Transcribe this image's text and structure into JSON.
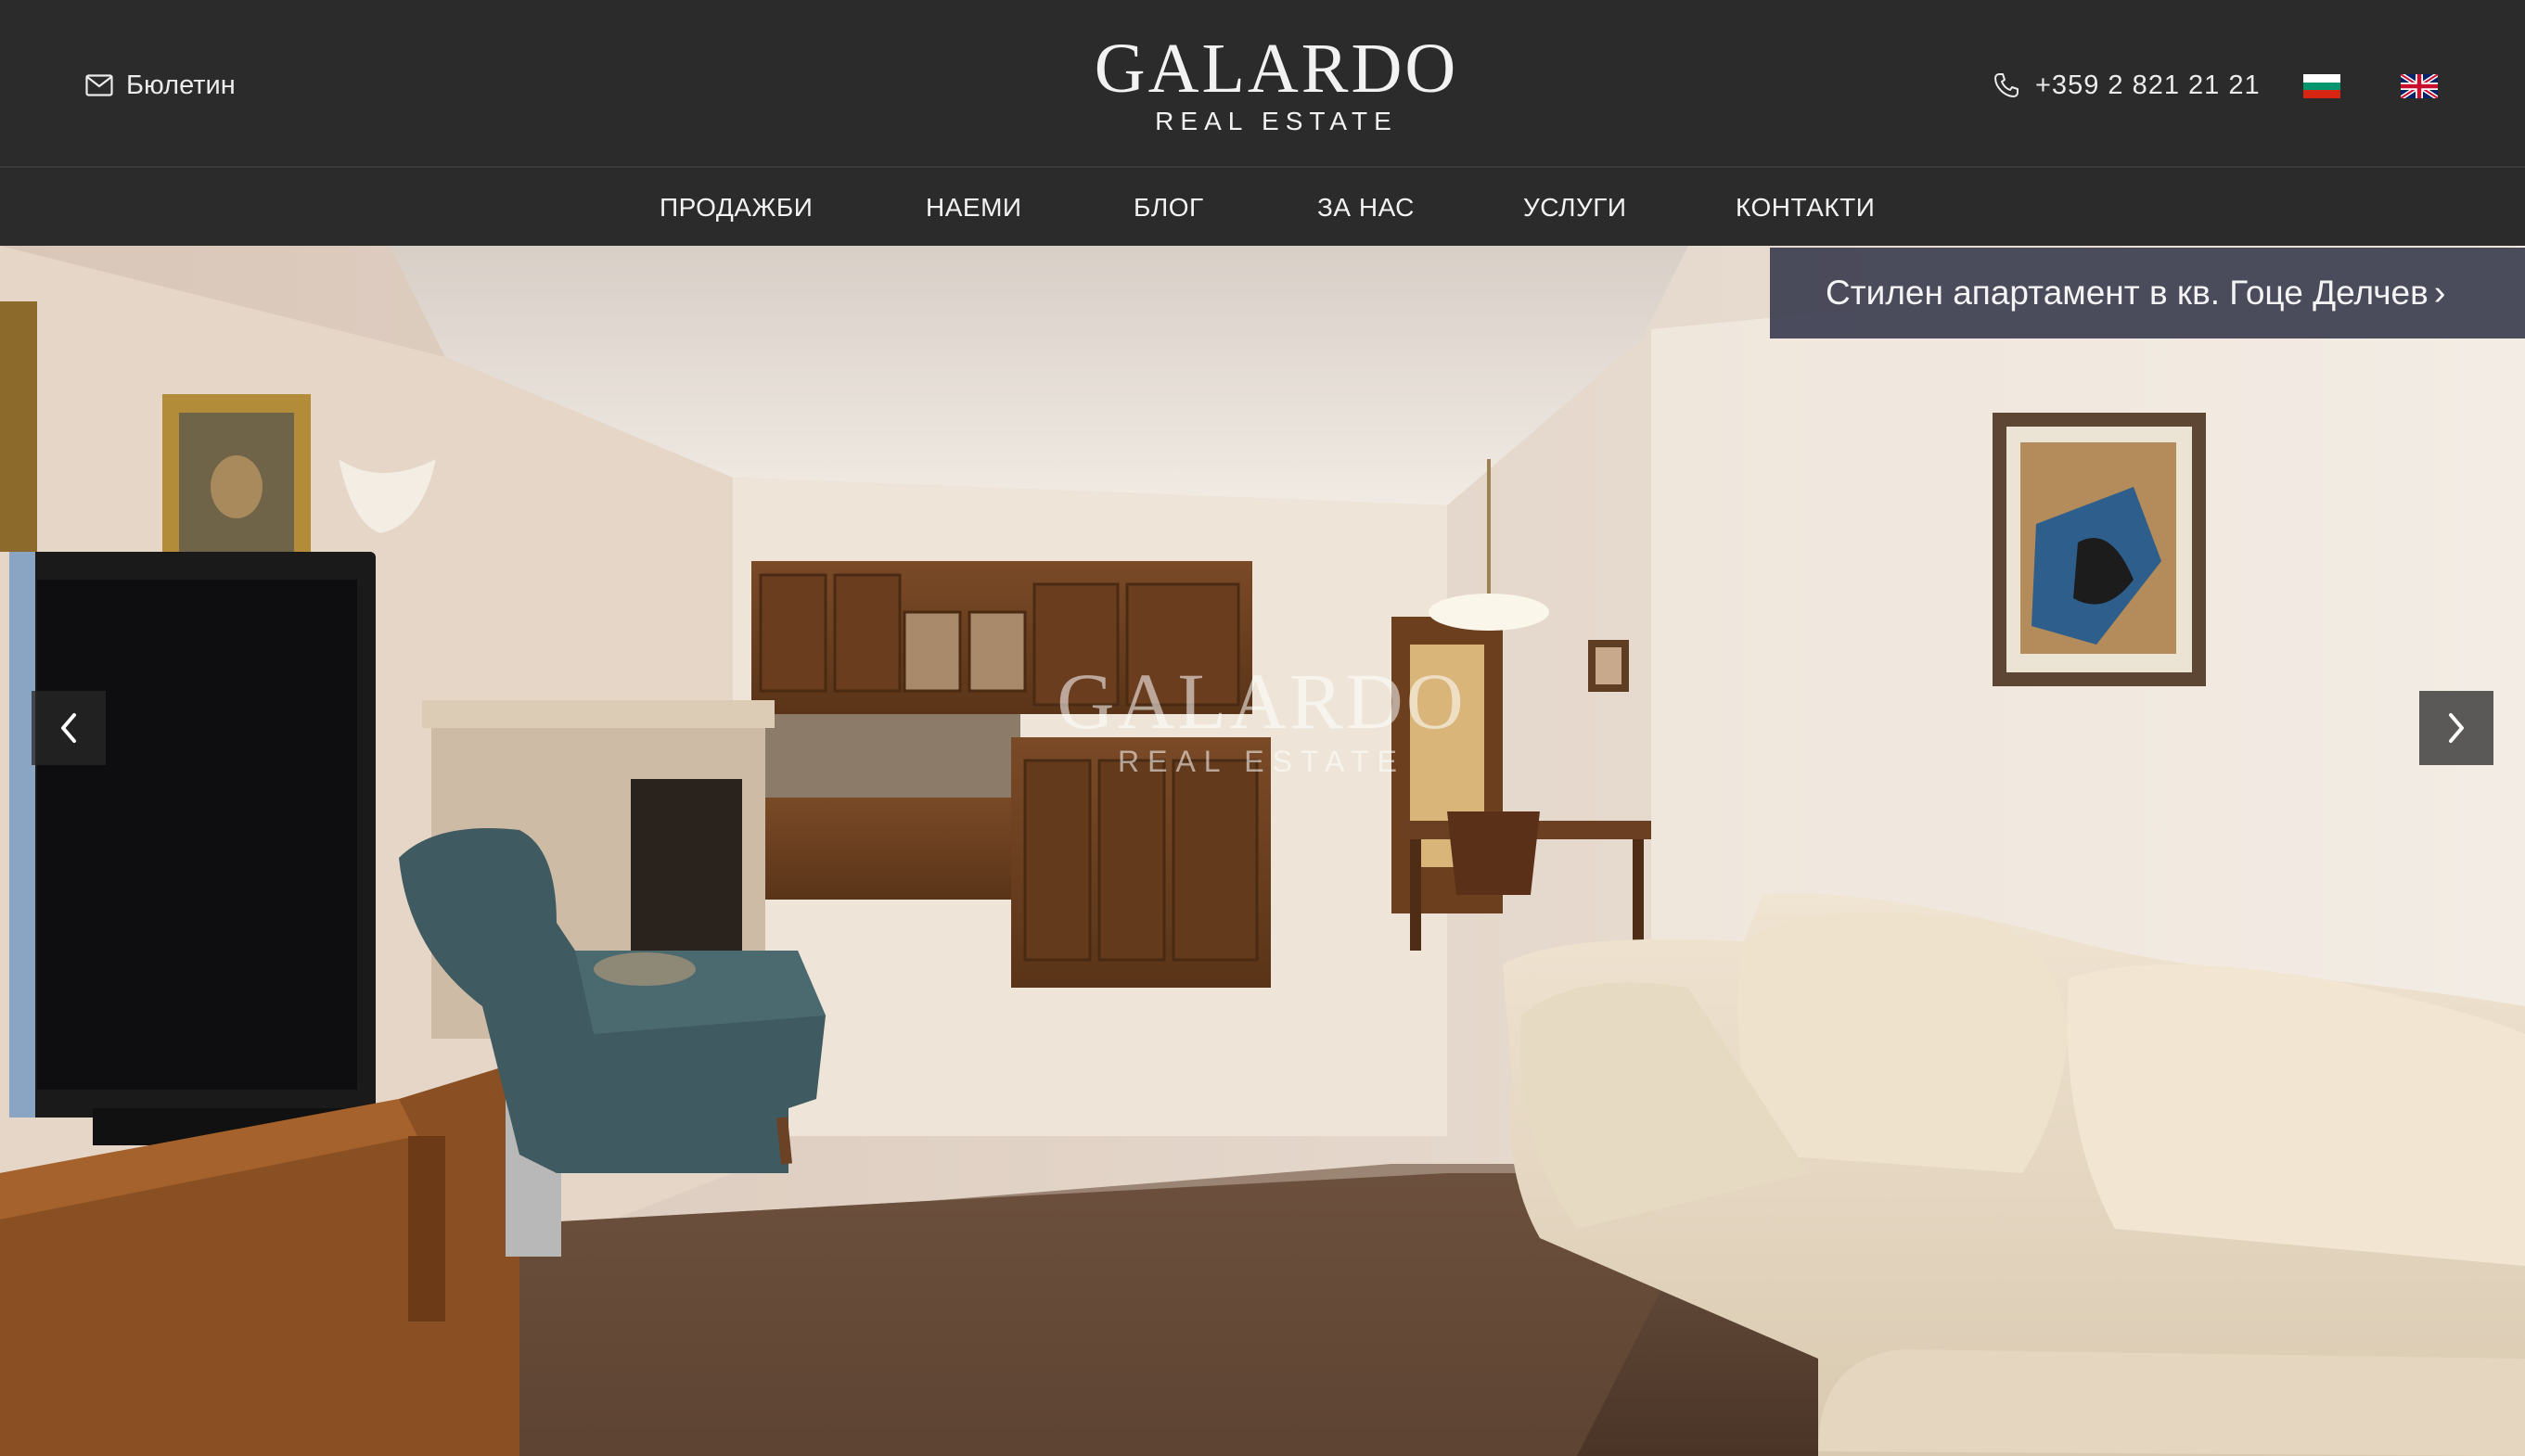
{
  "header": {
    "newsletter_label": "Бюлетин",
    "logo_main": "GALARDO",
    "logo_sub": "REAL ESTATE",
    "phone": "+359 2 821 21 21",
    "flags": [
      "bulgarian-flag-icon",
      "uk-flag-icon"
    ]
  },
  "nav": {
    "items": [
      {
        "label": "ПРОДАЖБИ"
      },
      {
        "label": "НАЕМИ"
      },
      {
        "label": "БЛОГ"
      },
      {
        "label": "ЗА НАС"
      },
      {
        "label": "УСЛУГИ"
      },
      {
        "label": "КОНТАКТИ"
      }
    ]
  },
  "hero": {
    "listing_title": "Стилен апартамент в кв. Гоце Делчев",
    "watermark_main": "GALARDO",
    "watermark_sub": "REAL ESTATE",
    "image_subject": "living room interior with kitchen, fireplace, TV, armchair and sofa"
  },
  "colors": {
    "header_bg": "#2b2b2b",
    "text": "#f2f2f2",
    "title_overlay": "#3c3e50"
  }
}
